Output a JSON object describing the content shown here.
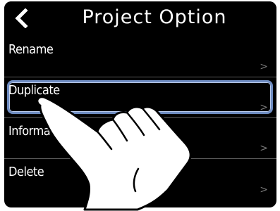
{
  "header": {
    "title": "Project Option",
    "back_icon": "chevron-left-icon"
  },
  "menu": {
    "items": [
      {
        "label": "Rename",
        "chevron": ">",
        "selected": false
      },
      {
        "label": "Duplicate",
        "chevron": ">",
        "selected": true
      },
      {
        "label": "Information",
        "chevron": ">",
        "selected": false
      },
      {
        "label": "Delete",
        "chevron": ">",
        "selected": false
      }
    ]
  },
  "colors": {
    "background": "#000000",
    "selection_outline": "#6f8dc2",
    "divider": "#5a5a5a"
  },
  "overlay": {
    "icon": "pointing-hand-icon"
  }
}
